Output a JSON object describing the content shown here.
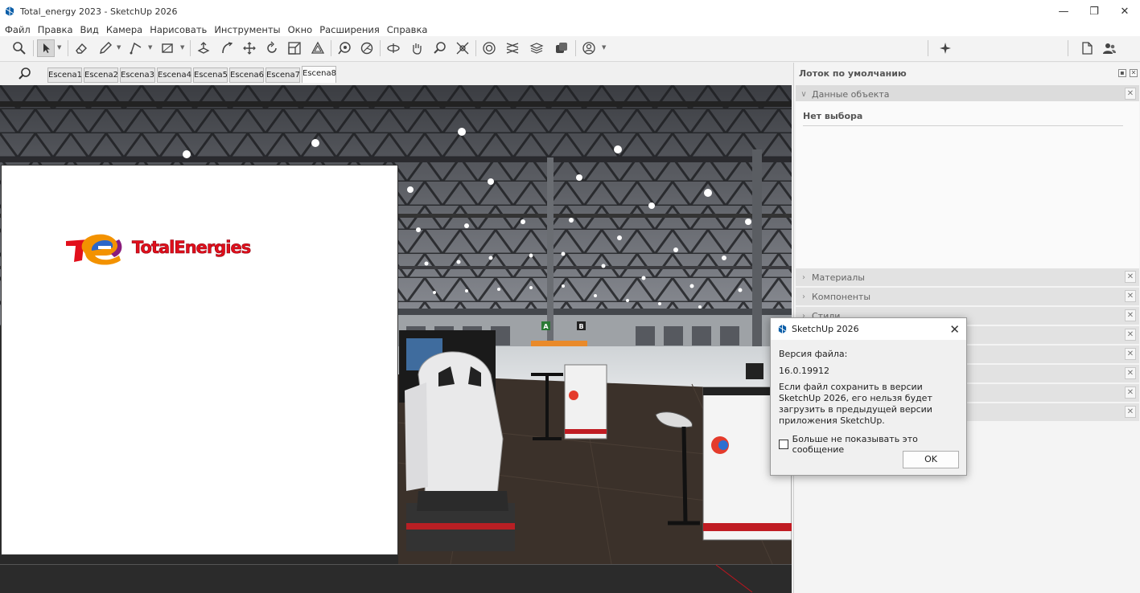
{
  "window": {
    "title": "Total_energy 2023 - SketchUp 2026",
    "minimize": "—",
    "restore": "❐",
    "close": "✕"
  },
  "menu": [
    "Файл",
    "Правка",
    "Вид",
    "Камера",
    "Нарисовать",
    "Инструменты",
    "Окно",
    "Расширения",
    "Справка"
  ],
  "toolbar": {
    "tools": [
      "search-icon",
      "select-arrow-icon",
      "eraser-icon",
      "pencil-icon",
      "line-icon",
      "rectangle-icon",
      "push-pull-icon",
      "follow-me-icon",
      "move-icon",
      "rotate-icon",
      "scale-icon",
      "offset-icon",
      "tape-measure-icon",
      "protractor-icon",
      "orbit-icon",
      "pan-icon",
      "zoom-icon",
      "zoom-extents-icon",
      "components-icon",
      "section-icon",
      "layers-icon",
      "styles-icon",
      "account-icon"
    ],
    "right_tools": [
      "sparkle-icon",
      "new-file-icon",
      "users-icon"
    ]
  },
  "scenes": {
    "tabs": [
      "Escena1",
      "Escena2",
      "Escena3",
      "Escena4",
      "Escena5",
      "Escena6",
      "Escena7",
      "Escena8"
    ],
    "active": "Escena8"
  },
  "viewport": {
    "logo_text": "TotalEnergies",
    "sign_letters": [
      "A",
      "B"
    ]
  },
  "tray": {
    "title": "Лоток по умолчанию",
    "entity_info": {
      "label": "Данные объекта",
      "body": "Нет выбора"
    },
    "panels": [
      "Материалы",
      "Компоненты",
      "Стили",
      "",
      "",
      "",
      "",
      ""
    ]
  },
  "dialog": {
    "title": "SketchUp 2026",
    "version_label": "Версия файла:",
    "version_value": "16.0.19912",
    "message": "Если файл сохранить в версии SketchUp 2026, его нельзя будет загрузить в предыдущей версии приложения SketchUp.",
    "checkbox_label": "Больше не показывать это сообщение",
    "checkbox_checked": false,
    "ok_label": "OK"
  },
  "colors": {
    "accent": "#0a7bd6",
    "brand_red": "#e20f1b"
  }
}
